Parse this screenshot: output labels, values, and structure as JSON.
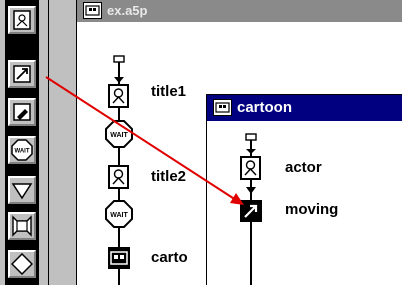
{
  "palette": {
    "tools": [
      {
        "icon": "display-icon"
      },
      {
        "icon": "motion-icon"
      },
      {
        "icon": "erase-icon"
      },
      {
        "icon": "wait-icon",
        "label": "WAIT"
      },
      {
        "icon": "decision-icon"
      },
      {
        "icon": "interaction-icon"
      },
      {
        "icon": "calculation-icon"
      }
    ]
  },
  "main_window": {
    "title": "ex.a5p",
    "icons": [
      {
        "label": "title1",
        "icon": "display-icon"
      },
      {
        "label": "",
        "icon": "wait-icon",
        "badge": "WAIT"
      },
      {
        "label": "title2",
        "icon": "display-icon"
      },
      {
        "label": "",
        "icon": "wait-icon",
        "badge": "WAIT"
      },
      {
        "label": "carto",
        "icon": "map-icon"
      }
    ]
  },
  "cartoon_window": {
    "title": "cartoon",
    "icons": [
      {
        "label": "actor",
        "icon": "display-icon"
      },
      {
        "label": "moving",
        "icon": "motion-icon"
      }
    ]
  },
  "colors": {
    "drag_arrow": "#e00000",
    "active_titlebar": "#000080",
    "inactive_titlebar": "#8a8a8a"
  }
}
